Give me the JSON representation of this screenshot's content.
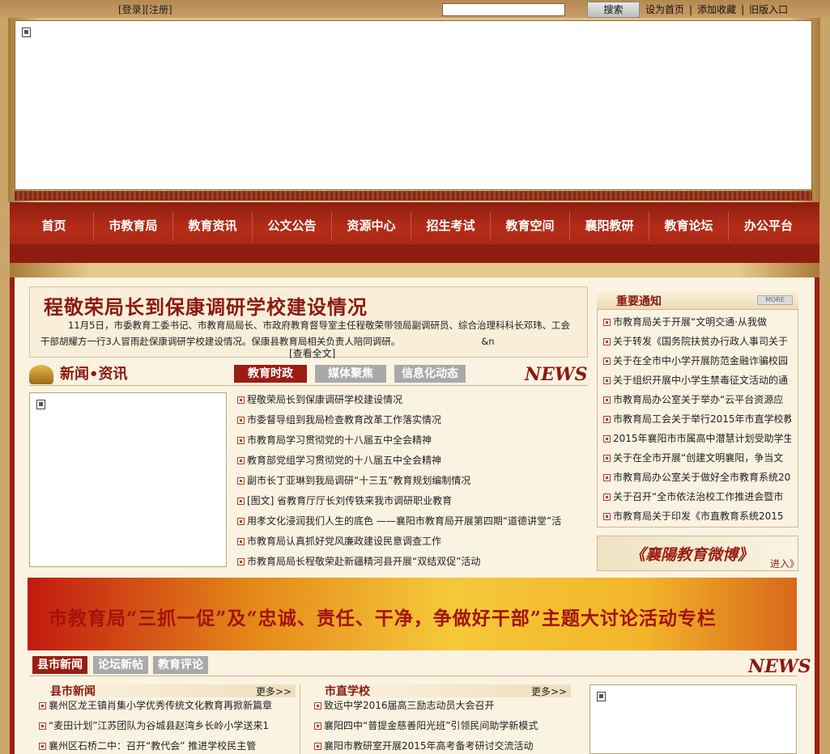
{
  "topbar": {
    "login": "[登录]",
    "register": "[注册]",
    "search_button": "搜索",
    "links": [
      "设为首页",
      "添加收藏",
      "旧版入口"
    ],
    "separator": "|"
  },
  "nav": {
    "items": [
      "首页",
      "市教育局",
      "教育资讯",
      "公文公告",
      "资源中心",
      "招生考试",
      "教育空间",
      "襄阳教研",
      "教育论坛",
      "办公平台"
    ]
  },
  "headline": {
    "title": "程敬荣局长到保康调研学校建设情况",
    "summary": "11月5日，市委教育工委书记、市教育局局长、市政府教育督导室主任程敬荣带领局副调研员、综合治理科科长邓玮、工会干部胡耀方一行3人冒雨赴保康调研学校建设情况。保康县教育局相关负责人陪同调研。",
    "suffix": "&n",
    "more": "[查看全文]"
  },
  "news_section": {
    "logo": "新闻•资讯",
    "tabs": [
      "教育时政",
      "媒体聚焦",
      "信息化动态"
    ],
    "news_word": "NEWS",
    "items": [
      "程敬荣局长到保康调研学校建设情况",
      "市委督导组到我局检查教育改革工作落实情况",
      "市教育局学习贯彻党的十八届五中全会精神",
      "教育部党组学习贯彻党的十八届五中全会精神",
      "副市长丁亚琳到我局调研“十三五”教育规划编制情况",
      "[图文] 省教育厅厅长刘传铁来我市调研职业教育",
      "用孝文化浸润我们人生的底色 ——襄阳市教育局开展第四期“道德讲堂”活",
      "市教育局认真抓好党风廉政建设民意调查工作",
      "市教育局局长程敬荣赴新疆精河县开展“双结双促”活动"
    ]
  },
  "notice": {
    "title": "重要通知",
    "more": "MORE",
    "items": [
      "市教育局关于开展“文明交通·从我做",
      "关于转发《国务院扶贫办行政人事司关于",
      "关于在全市中小学开展防范金融诈骗校园",
      "关于组织开展中小学生禁毒征文活动的通",
      "市教育局办公室关于举办“云平台资源应",
      "市教育局工会关于举行2015年市直学校教职",
      "2015年襄阳市市属高中潜慧计划受助学生",
      "关于在全市开展“创建文明襄阳，争当文",
      "市教育局办公室关于做好全市教育系统20",
      "关于召开“全市依法治校工作推进会暨市",
      "市教育局关于印发《市直教育系统2015"
    ]
  },
  "weibo": {
    "title": "《襄陽教育微博》",
    "enter": "进入》"
  },
  "special_banner": {
    "text": "市教育局“三抓一促”及“忠诚、责任、干净，争做好干部”主题大讨论活动专栏"
  },
  "bottom": {
    "tabs": [
      "县市新闻",
      "论坛新帖",
      "教育评论"
    ],
    "news_word": "NEWS",
    "county": {
      "title": "县市新闻",
      "more": "更多>>",
      "items": [
        "襄州区龙王镇肖集小学优秀传统文化教育再掀新篇章",
        "“麦田计划”江苏团队为谷城县赵湾乡长岭小学送来1",
        "襄州区石桥二中：召开“教代会” 推进学校民主管"
      ]
    },
    "school": {
      "title": "市直学校",
      "more": "更多>>",
      "items": [
        "致远中学2016届高三励志动员大会召开",
        "襄阳四中“普提金慈善阳光班”引领民间助学新模式",
        "襄阳市教研室开展2015年高考备考研讨交流活动"
      ]
    }
  }
}
